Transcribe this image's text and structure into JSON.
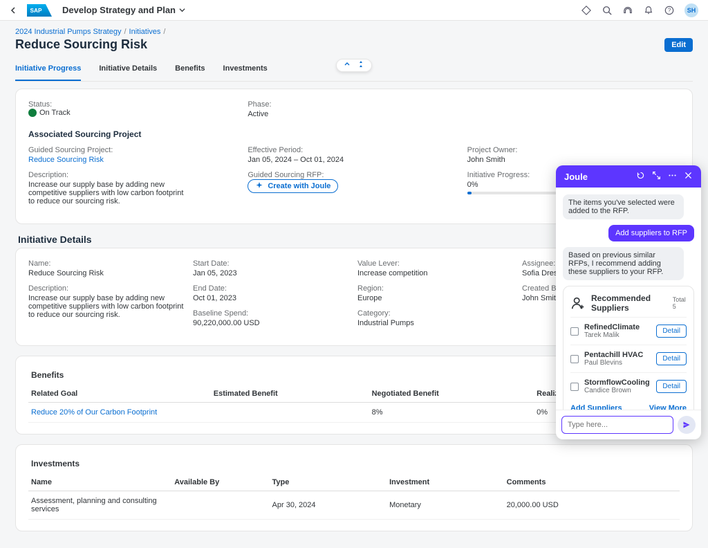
{
  "shell": {
    "title": "Develop Strategy and Plan",
    "avatar": "SH"
  },
  "breadcrumbs": [
    "2024 Industrial Pumps Strategy",
    "Initiatives"
  ],
  "page_title": "Reduce Sourcing Risk",
  "edit_btn": "Edit",
  "tabs": [
    "Initiative Progress",
    "Initiative Details",
    "Benefits",
    "Investments"
  ],
  "progress": {
    "status_label": "Status:",
    "status_value": "On Track",
    "phase_label": "Phase:",
    "phase_value": "Active",
    "assoc_head": "Associated Sourcing Project",
    "c1": {
      "guided_project_label": "Guided Sourcing Project:",
      "guided_project_value": "Reduce Sourcing Risk",
      "desc_label": "Description:",
      "desc_value": "Increase our supply base by adding new competitive suppliers with low carbon footprint to reduce our sourcing risk."
    },
    "c2": {
      "effective_label": "Effective Period:",
      "effective_value": "Jan 05, 2024 – Oct 01, 2024",
      "grfp_label": "Guided Sourcing RFP:",
      "create_btn": "Create with Joule"
    },
    "c3": {
      "owner_label": "Project Owner:",
      "owner_value": "John Smith",
      "prog_label": "Initiative Progress:",
      "prog_value": "0%"
    }
  },
  "details": {
    "section_title": "Initiative Details",
    "fields": {
      "name_label": "Name:",
      "name_value": "Reduce Sourcing Risk",
      "desc_label": "Description:",
      "desc_value": "Increase our supply base by adding new competitive suppliers with low carbon footprint to reduce our sourcing risk.",
      "start_label": "Start Date:",
      "start_value": "Jan 05, 2023",
      "end_label": "End Date:",
      "end_value": "Oct 01, 2023",
      "baseline_label": "Baseline Spend:",
      "baseline_value": "90,220,000.00 USD",
      "lever_label": "Value Lever:",
      "lever_value": "Increase competition",
      "region_label": "Region:",
      "region_value": "Europe",
      "cat_label": "Category:",
      "cat_value": "Industrial Pumps",
      "assignee_label": "Assignee:",
      "assignee_value": "Sofia Dresch",
      "creator_label": "Created By:",
      "creator_value": "John Smith"
    }
  },
  "benefits": {
    "head": "Benefits",
    "cols": [
      "Related Goal",
      "Estimated Benefit",
      "Negotiated Benefit",
      "Realized Benefit"
    ],
    "row": {
      "goal": "Reduce 20% of Our Carbon Footprint",
      "neg": "8%",
      "real": "0%"
    }
  },
  "investments": {
    "head": "Investments",
    "cols": [
      "Name",
      "Available By",
      "Type",
      "Investment",
      "Comments"
    ],
    "row": {
      "name": "Assessment, planning and consulting services",
      "avail": "Apr 30, 2024",
      "type": "Monetary",
      "inv": "20,000.00 USD"
    }
  },
  "joule": {
    "title": "Joule",
    "msg_in1": "The items you've selected were added to the RFP.",
    "msg_out": "Add suppliers to RFP",
    "msg_in2": "Based on previous similar RFPs, I recommend adding these suppliers to your RFP.",
    "card_title": "Recommended Suppliers",
    "total": "Total 5",
    "suppliers": [
      {
        "name": "RefinedClimate",
        "contact": "Tarek Malik"
      },
      {
        "name": "Pentachill HVAC",
        "contact": "Paul Blevins"
      },
      {
        "name": "StormflowCooling",
        "contact": "Candice Brown"
      }
    ],
    "detail_btn": "Detail",
    "add_btn": "Add Suppliers",
    "view_more": "View More",
    "input_placeholder": "Type here..."
  }
}
